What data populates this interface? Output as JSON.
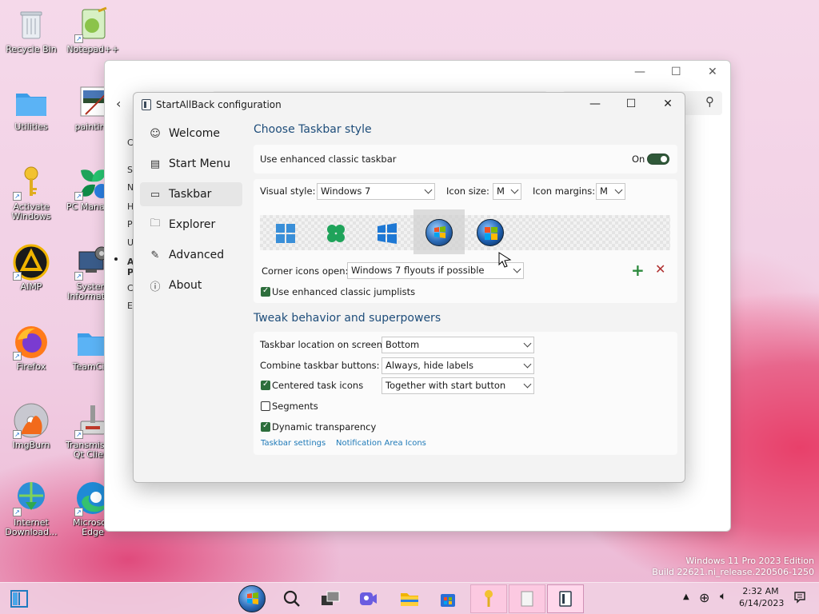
{
  "desktop": {
    "icons": [
      {
        "label": "Recycle Bin"
      },
      {
        "label": "Notepad++"
      },
      {
        "label": "Utilities"
      },
      {
        "label": "painting"
      },
      {
        "label": "Activate Windows"
      },
      {
        "label": "PC Manager"
      },
      {
        "label": "AIMP"
      },
      {
        "label": "System Information"
      },
      {
        "label": "Firefox"
      },
      {
        "label": "TeamCity"
      },
      {
        "label": "ImgBurn"
      },
      {
        "label": "Transmission Qt Client"
      },
      {
        "label": "Internet Download..."
      },
      {
        "label": "Microsoft Edge"
      }
    ]
  },
  "explorer": {
    "side_letters": [
      "C",
      "S",
      "N",
      "H",
      "P",
      "U",
      "A",
      "P",
      "C",
      "E"
    ]
  },
  "dialog": {
    "title": "StartAllBack configuration",
    "nav": [
      {
        "label": "Welcome",
        "icon": "smile-icon"
      },
      {
        "label": "Start Menu",
        "icon": "start-menu-icon"
      },
      {
        "label": "Taskbar",
        "icon": "taskbar-icon"
      },
      {
        "label": "Explorer",
        "icon": "folder-icon"
      },
      {
        "label": "Advanced",
        "icon": "wrench-icon"
      },
      {
        "label": "About",
        "icon": "info-icon"
      }
    ],
    "section1_title": "Choose Taskbar style",
    "enhanced_taskbar_label": "Use enhanced classic taskbar",
    "enhanced_taskbar_state": "On",
    "visual_style_label": "Visual style:",
    "visual_style_value": "Windows 7",
    "icon_size_label": "Icon size:",
    "icon_size_value": "M",
    "icon_margins_label": "Icon margins:",
    "icon_margins_value": "M",
    "corner_icons_label": "Corner icons open:",
    "corner_icons_value": "Windows 7 flyouts if possible",
    "jumplists_label": "Use enhanced classic jumplists",
    "section2_title": "Tweak behavior and superpowers",
    "location_label": "Taskbar location on screen:",
    "location_value": "Bottom",
    "combine_label": "Combine taskbar buttons:",
    "combine_value": "Always, hide labels",
    "centered_label": "Centered task icons",
    "centered_value": "Together with start button",
    "segments_label": "Segments",
    "dynamic_label": "Dynamic transparency",
    "link_taskbar_settings": "Taskbar settings",
    "link_notification": "Notification Area Icons"
  },
  "watermark": {
    "line1": "Windows 11 Pro 2023 Edition",
    "line2": "Build 22621.ni_release.220506-1250"
  },
  "tray": {
    "time": "2:32 AM",
    "date": "6/14/2023"
  },
  "colors": {
    "accent_green": "#2d6e3c",
    "link_blue": "#1f7ab8",
    "heading_blue": "#1e4d7a"
  }
}
